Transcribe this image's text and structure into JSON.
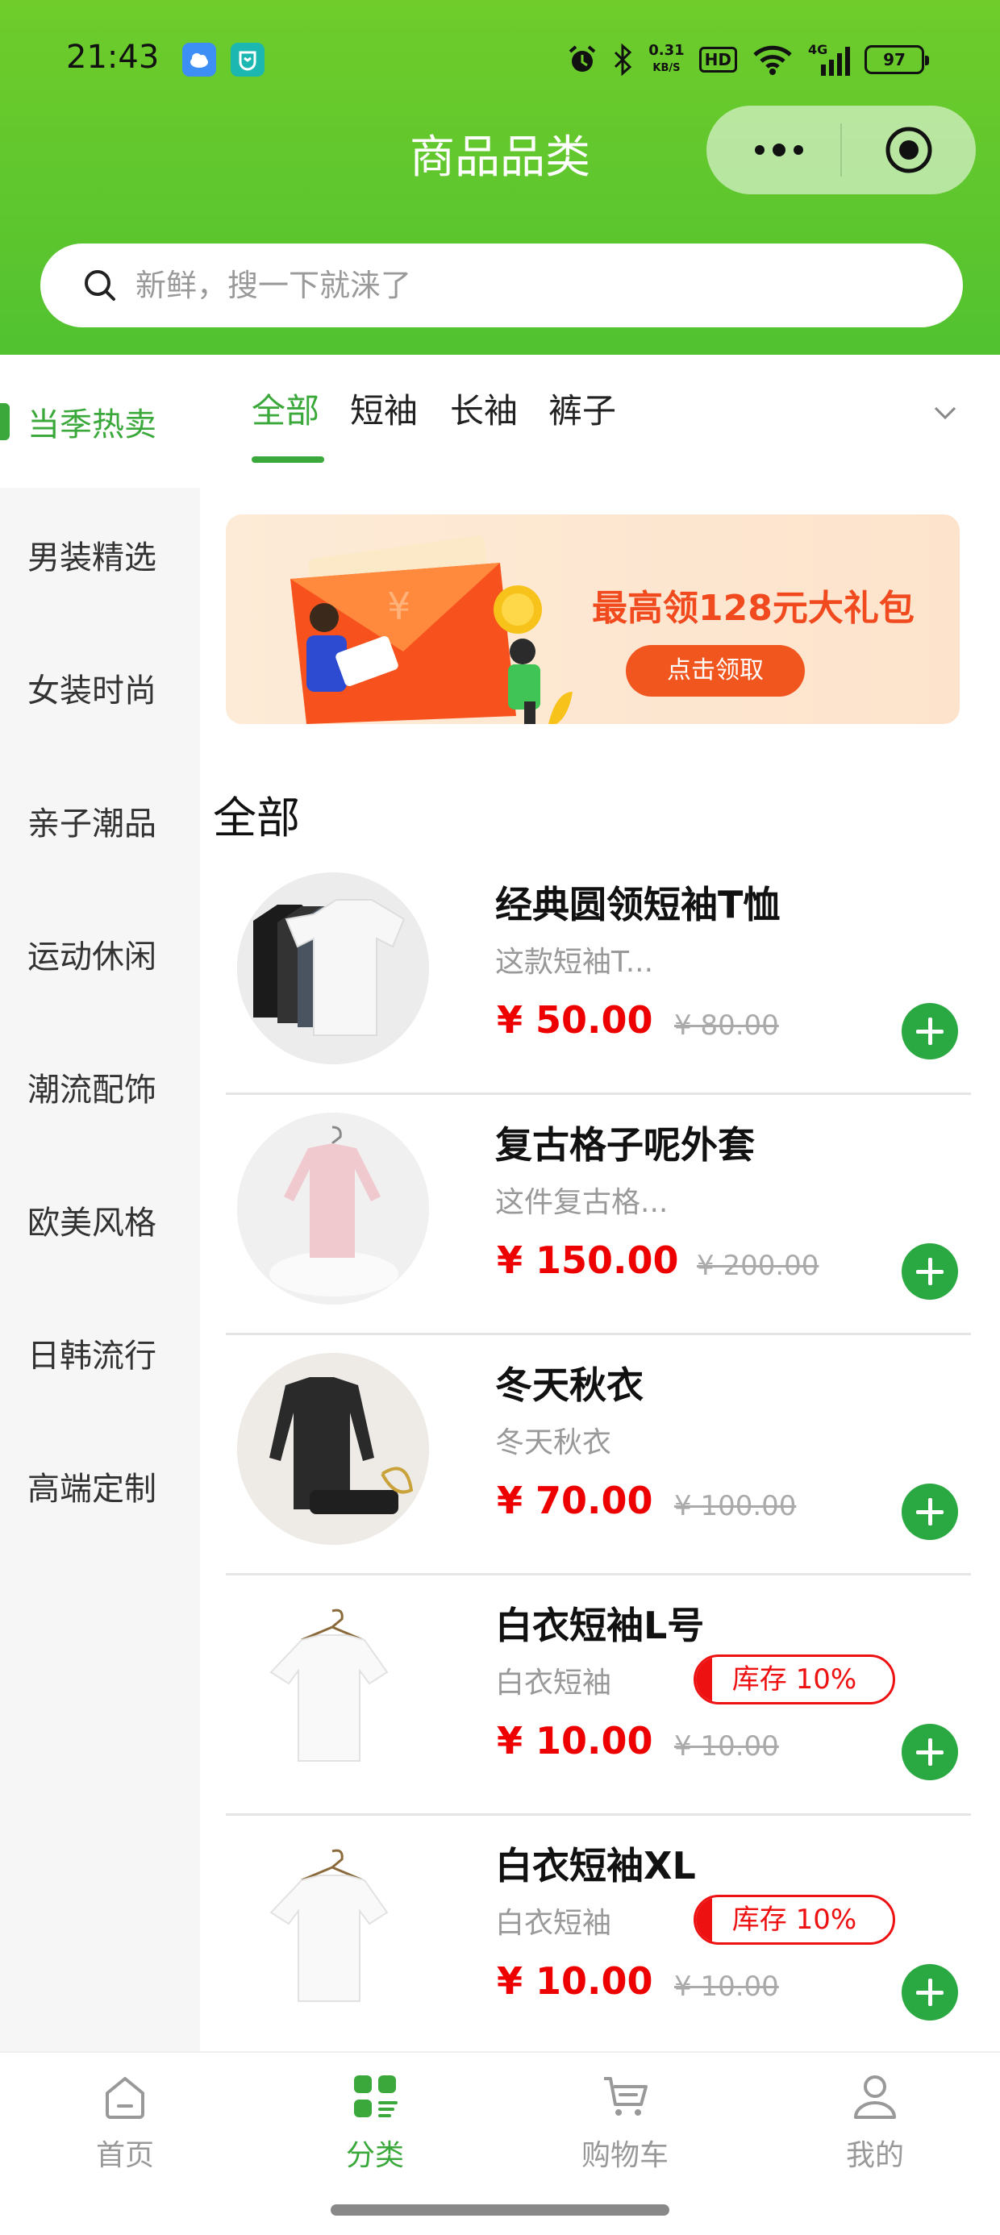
{
  "status_bar": {
    "time": "21:43",
    "net_speed_value": "0.31",
    "net_speed_unit": "KB/S",
    "hd_label": "HD",
    "network_label": "4G",
    "battery_level": "97"
  },
  "header": {
    "title": "商品品类",
    "search_placeholder": "新鲜，搜一下就涞了"
  },
  "sidebar": {
    "items": [
      {
        "label": "当季热卖"
      },
      {
        "label": "男装精选"
      },
      {
        "label": "女装时尚"
      },
      {
        "label": "亲子潮品"
      },
      {
        "label": "运动休闲"
      },
      {
        "label": "潮流配饰"
      },
      {
        "label": "欧美风格"
      },
      {
        "label": "日韩流行"
      },
      {
        "label": "高端定制"
      }
    ]
  },
  "tabs": [
    {
      "label": "全部"
    },
    {
      "label": "短袖"
    },
    {
      "label": "长袖"
    },
    {
      "label": "裤子"
    }
  ],
  "banner": {
    "headline": "最高领128元大礼包",
    "button_label": "点击领取"
  },
  "section": {
    "title": "全部"
  },
  "products": [
    {
      "name": "经典圆领短袖T恤",
      "desc": "这款短袖T...",
      "price": "¥ 50.00",
      "orig_price": "¥ 80.00"
    },
    {
      "name": "复古格子呢外套",
      "desc": "这件复古格...",
      "price": "¥ 150.00",
      "orig_price": "¥ 200.00"
    },
    {
      "name": "冬天秋衣",
      "desc": "冬天秋衣",
      "price": "¥ 70.00",
      "orig_price": "¥ 100.00"
    },
    {
      "name": "白衣短袖L号",
      "desc": "白衣短袖",
      "stock": "库存 10%",
      "price": "¥ 10.00",
      "orig_price": "¥ 10.00"
    },
    {
      "name": "白衣短袖XL",
      "desc": "白衣短袖",
      "stock": "库存 10%",
      "price": "¥ 10.00",
      "orig_price": "¥ 10.00"
    }
  ],
  "tabbar": [
    {
      "label": "首页",
      "icon": "home-icon"
    },
    {
      "label": "分类",
      "icon": "category-icon"
    },
    {
      "label": "购物车",
      "icon": "cart-icon"
    },
    {
      "label": "我的",
      "icon": "user-icon"
    }
  ],
  "colors": {
    "brand_green": "#52c230",
    "active_green": "#3aa83a",
    "price_red": "#e00000",
    "add_button_green": "#2aa841"
  }
}
